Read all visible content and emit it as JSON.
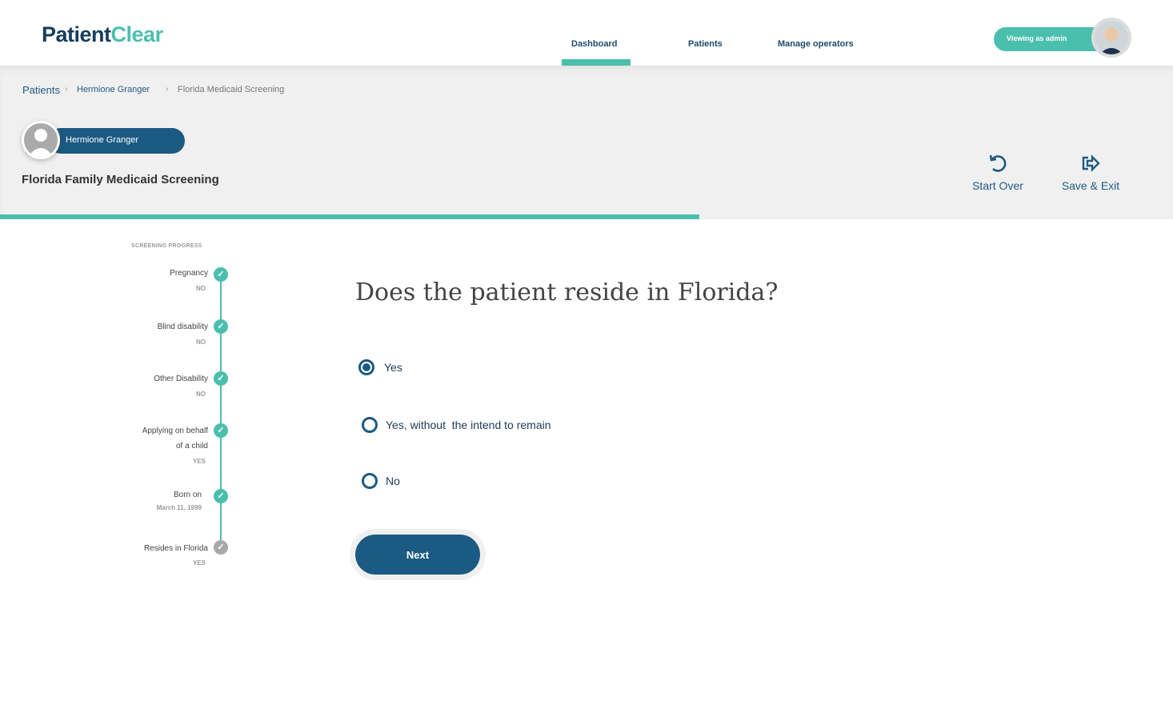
{
  "logo": {
    "part1": "Patient",
    "part2": "Clear"
  },
  "nav": [
    {
      "label": "Dashboard",
      "active": true
    },
    {
      "label": "Patients"
    },
    {
      "label": "Manage operators"
    }
  ],
  "admin_badge": "Viewing as admin",
  "breadcrumb": [
    "Patients",
    "Hermione Granger",
    "Florida Medicaid Screening"
  ],
  "patient": {
    "name": "Hermione Granger"
  },
  "screening_title": "Florida Family Medicaid Screening",
  "actions": {
    "start_over": "Start Over",
    "save_exit": "Save & Exit"
  },
  "progress_percent": 60,
  "sidebar": {
    "heading": "SCREENING PROGRESS",
    "steps": [
      {
        "label": "Pregnancy",
        "value": "NO",
        "status": "done"
      },
      {
        "label": "Blind disability",
        "value": "NO",
        "status": "done"
      },
      {
        "label": "Other Disability",
        "value": "NO",
        "status": "done"
      },
      {
        "label": "Applying on behalf of a child",
        "value": "YES",
        "status": "done"
      },
      {
        "label": "Born on",
        "value": "March 11, 1999",
        "status": "done"
      },
      {
        "label": "Resides in Florida",
        "value": "YES",
        "status": "current"
      }
    ]
  },
  "question": "Does the patient reside in Florida?",
  "options": [
    {
      "label": "Yes",
      "selected": true
    },
    {
      "label": "Yes, without  the intend to remain",
      "selected": false
    },
    {
      "label": "No",
      "selected": false
    }
  ],
  "next_label": "Next",
  "colors": {
    "primary": "#1b5a82",
    "accent": "#4bbfae"
  }
}
